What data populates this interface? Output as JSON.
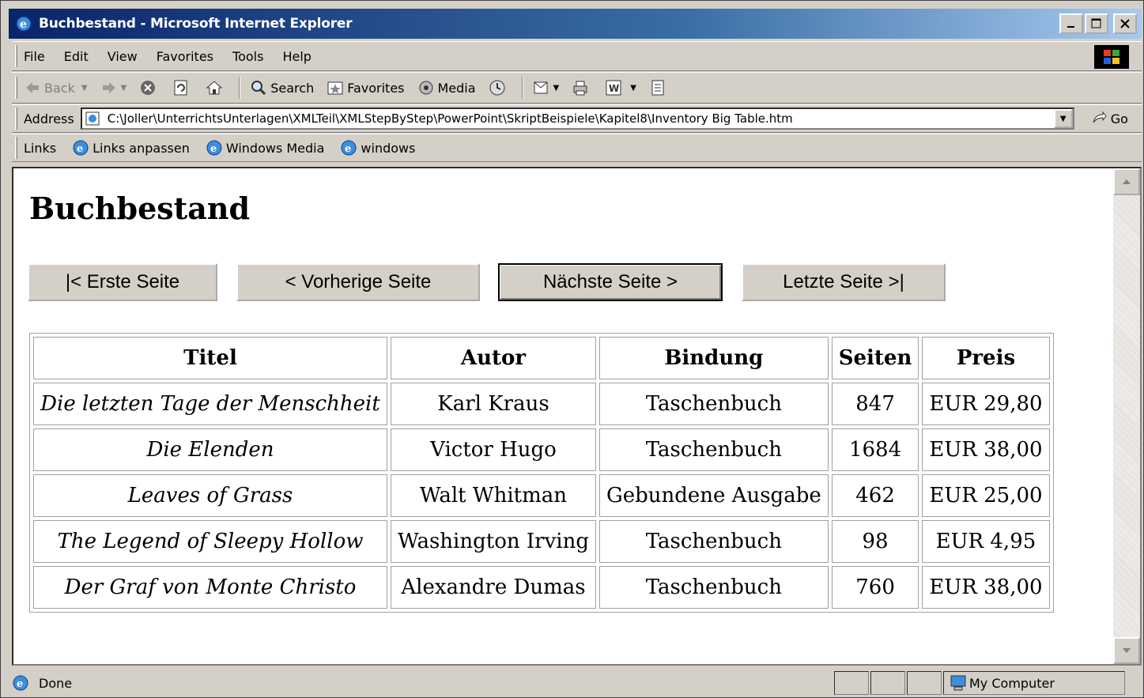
{
  "window": {
    "title": "Buchbestand - Microsoft Internet Explorer",
    "min_label": "_",
    "max_label": "□",
    "close_label": "✕"
  },
  "menu": {
    "items": [
      {
        "label": "File"
      },
      {
        "label": "Edit"
      },
      {
        "label": "View"
      },
      {
        "label": "Favorites"
      },
      {
        "label": "Tools"
      },
      {
        "label": "Help"
      }
    ]
  },
  "toolbar": {
    "back_label": "Back",
    "search_label": "Search",
    "favorites_label": "Favorites",
    "media_label": "Media"
  },
  "address": {
    "label": "Address",
    "url": "C:\\Joller\\UnterrichtsUnterlagen\\XMLTeil\\XMLStepByStep\\PowerPoint\\SkriptBeispiele\\Kapitel8\\Inventory Big Table.htm",
    "go_label": "Go"
  },
  "links": {
    "label": "Links",
    "items": [
      {
        "label": "Links anpassen"
      },
      {
        "label": "Windows Media"
      },
      {
        "label": "windows"
      }
    ]
  },
  "page": {
    "heading": "Buchbestand",
    "nav": {
      "first": "|< Erste Seite",
      "prev": "< Vorherige Seite",
      "next": "Nächste Seite >",
      "last": "Letzte Seite >|"
    },
    "table": {
      "headers": [
        "Titel",
        "Autor",
        "Bindung",
        "Seiten",
        "Preis"
      ],
      "rows": [
        [
          "Die letzten Tage der Menschheit",
          "Karl Kraus",
          "Taschenbuch",
          "847",
          "EUR 29,80"
        ],
        [
          "Die Elenden",
          "Victor Hugo",
          "Taschenbuch",
          "1684",
          "EUR 38,00"
        ],
        [
          "Leaves of Grass",
          "Walt Whitman",
          "Gebundene Ausgabe",
          "462",
          "EUR 25,00"
        ],
        [
          "The Legend of Sleepy Hollow",
          "Washington Irving",
          "Taschenbuch",
          "98",
          "EUR 4,95"
        ],
        [
          "Der Graf von Monte Christo",
          "Alexandre Dumas",
          "Taschenbuch",
          "760",
          "EUR 38,00"
        ]
      ]
    }
  },
  "status": {
    "text": "Done",
    "zone": "My Computer"
  }
}
